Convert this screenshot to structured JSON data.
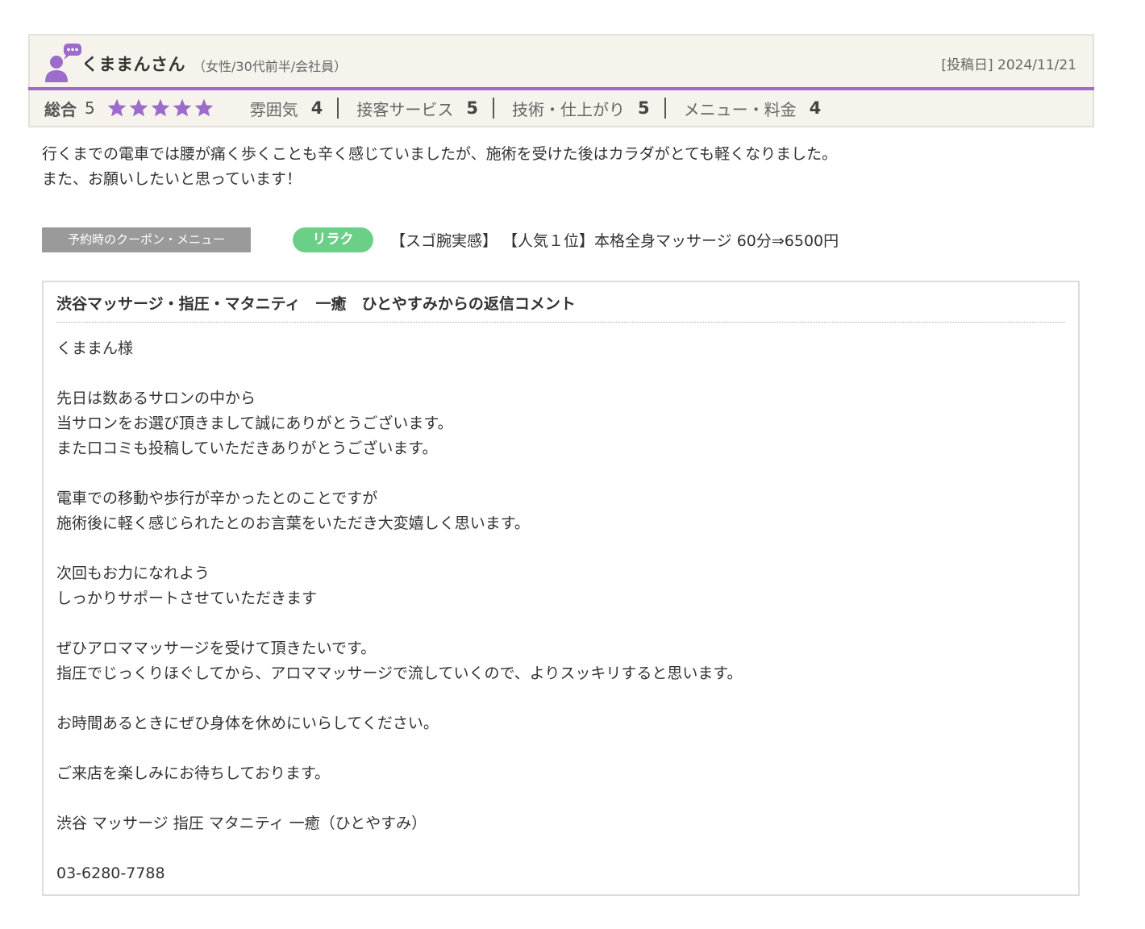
{
  "reviewer": {
    "name": "くままんさん",
    "attributes": "（女性/30代前半/会社員）",
    "post_date": "[投稿日] 2024/11/21"
  },
  "ratings": {
    "overall_label": "総合",
    "overall_value": "5",
    "stars_filled": 5,
    "stars_total": 5,
    "star_color": "#9b6cc9",
    "items": [
      {
        "label": "雰囲気",
        "score": "4"
      },
      {
        "label": "接客サービス",
        "score": "5"
      },
      {
        "label": "技術・仕上がり",
        "score": "5"
      },
      {
        "label": "メニュー・料金",
        "score": "4"
      }
    ]
  },
  "review_text": [
    "行くまでの電車では腰が痛く歩くことも辛く感じていましたが、施術を受けた後はカラダがとても軽くなりました。",
    "また、お願いしたいと思っています！"
  ],
  "coupon": {
    "label": "予約時のクーポン・メニュー",
    "badge": "リラク",
    "text": "【スゴ腕実感】 【人気１位】本格全身マッサージ 60分⇒6500円"
  },
  "reply": {
    "title": "渋谷マッサージ・指圧・マタニティ　一癒　ひとやすみからの返信コメント",
    "lines": [
      "くままん様",
      "",
      "先日は数あるサロンの中から",
      "当サロンをお選び頂きまして誠にありがとうございます。",
      "また口コミも投稿していただきありがとうございます。",
      "",
      "電車での移動や歩行が辛かったとのことですが",
      "施術後に軽く感じられたとのお言葉をいただき大変嬉しく思います。",
      "",
      "次回もお力になれよう",
      "しっかりサポートさせていただきます",
      "",
      "ぜひアロママッサージを受けて頂きたいです。",
      "指圧でじっくりほぐしてから、アロママッサージで流していくので、よりスッキリすると思います。",
      "",
      "お時間あるときにぜひ身体を休めにいらしてください。",
      "",
      "ご来店を楽しみにお待ちしております。",
      "",
      "渋谷 マッサージ 指圧 マタニティ 一癒（ひとやすみ）",
      "",
      "03-6280-7788"
    ]
  },
  "colors": {
    "accent_purple": "#9b6cc9",
    "badge_green": "#6ccf88",
    "header_bg": "#f6f3ec"
  }
}
